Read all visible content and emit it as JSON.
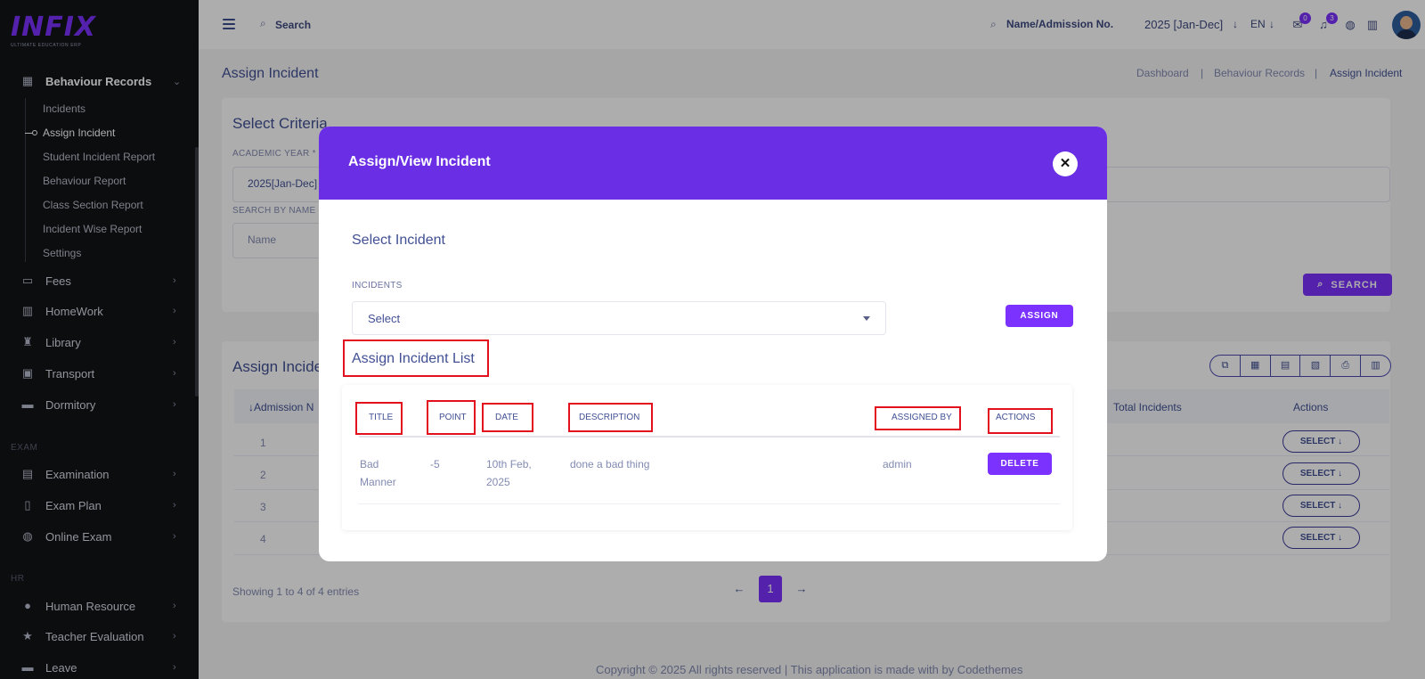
{
  "brand": {
    "name": "INFIX",
    "tagline": "ULTIMATE EDUCATION ERP"
  },
  "sidebar": {
    "open_group": {
      "label": "Behaviour Records",
      "icon": "file-stack-icon"
    },
    "sub_items": [
      "Incidents",
      "Assign Incident",
      "Student Incident Report",
      "Behaviour Report",
      "Class Section Report",
      "Incident Wise Report",
      "Settings"
    ],
    "active_sub": "Assign Incident",
    "items": [
      {
        "label": "Fees",
        "icon": "money-icon"
      },
      {
        "label": "HomeWork",
        "icon": "book-icon"
      },
      {
        "label": "Library",
        "icon": "library-icon"
      },
      {
        "label": "Transport",
        "icon": "bus-icon"
      },
      {
        "label": "Dormitory",
        "icon": "bed-icon"
      }
    ],
    "section_exam": "EXAM",
    "exam_items": [
      {
        "label": "Examination",
        "icon": "map-icon"
      },
      {
        "label": "Exam Plan",
        "icon": "clipboard-icon"
      },
      {
        "label": "Online Exam",
        "icon": "globe-icon"
      }
    ],
    "section_hr": "HR",
    "hr_items": [
      {
        "label": "Human Resource",
        "icon": "people-icon"
      },
      {
        "label": "Teacher Evaluation",
        "icon": "star-icon"
      },
      {
        "label": "Leave",
        "icon": "bed-icon"
      }
    ]
  },
  "header": {
    "search_label": "Search",
    "admission_search": "Name/Admission No.",
    "year": "2025 [Jan-Dec]",
    "language": "EN",
    "message_count": "0",
    "notification_count": "3"
  },
  "page": {
    "title": "Assign Incident",
    "breadcrumb": [
      "Dashboard",
      "Behaviour Records",
      "Assign Incident"
    ],
    "criteria_title": "Select Criteria",
    "academic_year_label": "ACADEMIC YEAR *",
    "academic_year_value": "2025[Jan-Dec]",
    "search_by_name_label": "SEARCH BY NAME",
    "name_placeholder": "Name",
    "search_button": "SEARCH",
    "list_title": "Assign Incide",
    "table_headers": {
      "admission": "Admission N",
      "total": "Total Incidents",
      "actions": "Actions"
    },
    "rows": [
      "1",
      "2",
      "3",
      "4"
    ],
    "select_label": "SELECT",
    "showing": "Showing 1 to 4 of 4 entries",
    "page_number": "1",
    "footer": "Copyright © 2025 All rights reserved | This application is made with by Codethemes"
  },
  "modal": {
    "title": "Assign/View Incident",
    "select_incident_title": "Select Incident",
    "incidents_label": "INCIDENTS",
    "incidents_value": "Select",
    "assign_button": "ASSIGN",
    "list_title": "Assign Incident List",
    "columns": [
      "TITLE",
      "POINT",
      "DATE",
      "DESCRIPTION",
      "ASSIGNED BY",
      "ACTIONS"
    ],
    "row": {
      "title": "Bad Manner",
      "point": "-5",
      "date": "10th Feb, 2025",
      "description": "done a bad thing",
      "assigned_by": "admin",
      "action": "DELETE"
    }
  },
  "colors": {
    "accent": "#7c32ff",
    "modal_header": "#6a2fe5",
    "annotation": "#e3111d",
    "sidebar": "#131416"
  }
}
